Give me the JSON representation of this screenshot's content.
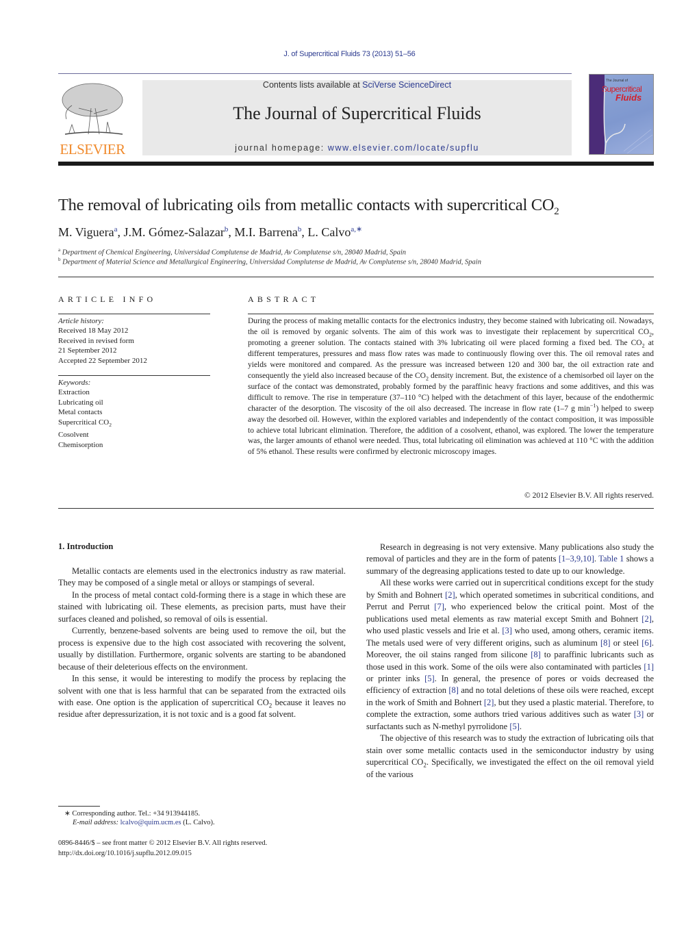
{
  "header": {
    "citation": "J. of Supercritical Fluids 73 (2013) 51–56",
    "contents_prefix": "Contents lists available at ",
    "contents_link": "SciVerse ScienceDirect",
    "journal_title": "The Journal of Supercritical Fluids",
    "homepage_prefix": "journal homepage: ",
    "homepage_link": "www.elsevier.com/locate/supflu",
    "publisher_logo_text": "ELSEVIER",
    "cover": {
      "small_text": "The Journal of",
      "title_line1": "Supercritical",
      "title_line2": "Fluids"
    },
    "colors": {
      "link": "#2b3a8f",
      "elsevier_orange": "#f08a2c",
      "cover_red": "#d4202a",
      "cover_purple": "#4b2c78"
    }
  },
  "article": {
    "title_main": "The removal of lubricating oils from metallic contacts with supercritical CO",
    "title_sub": "2",
    "authors": [
      {
        "name": "M. Viguera",
        "sup": "a"
      },
      {
        "name": "J.M. Gómez-Salazar",
        "sup": "b"
      },
      {
        "name": "M.I. Barrena",
        "sup": "b"
      },
      {
        "name": "L. Calvo",
        "sup": "a,∗"
      }
    ],
    "affiliations": [
      {
        "mark": "a",
        "text": "Department of Chemical Engineering, Universidad Complutense de Madrid, Av Complutense s/n, 28040 Madrid, Spain"
      },
      {
        "mark": "b",
        "text": "Department of Material Science and Metallurgical Engineering, Universidad Complutense de Madrid, Av Complutense s/n, 28040 Madrid, Spain"
      }
    ]
  },
  "article_info": {
    "heading": "ARTICLE INFO",
    "history_label": "Article history:",
    "history": [
      "Received 18 May 2012",
      "Received in revised form",
      "21 September 2012",
      "Accepted 22 September 2012"
    ],
    "keywords_label": "Keywords:",
    "keywords": [
      {
        "text": "Extraction"
      },
      {
        "text": "Lubricating oil"
      },
      {
        "text": "Metal contacts"
      },
      {
        "text": "Supercritical CO",
        "sub": "2"
      },
      {
        "text": "Cosolvent"
      },
      {
        "text": "Chemisorption"
      }
    ]
  },
  "abstract": {
    "heading": "ABSTRACT",
    "segments": [
      "During the process of making metallic contacts for the electronics industry, they become stained with lubricating oil. Nowadays, the oil is removed by organic solvents. The aim of this work was to investigate their replacement by supercritical CO",
      "2",
      ", promoting a greener solution. The contacts stained with 3% lubricating oil were placed forming a fixed bed. The CO",
      "2",
      " at different temperatures, pressures and mass flow rates was made to continuously flowing over this. The oil removal rates and yields were monitored and compared. As the pressure was increased between 120 and 300 bar, the oil extraction rate and consequently the yield also increased because of the CO",
      "2",
      " density increment. But, the existence of a chemisorbed oil layer on the surface of the contact was demonstrated, probably formed by the paraffinic heavy fractions and some additives, and this was difficult to remove. The rise in temperature (37–110 °C) helped with the detachment of this layer, because of the endothermic character of the desorption. The viscosity of the oil also decreased. The increase in flow rate (1–7 g min",
      "−1",
      ") helped to sweep away the desorbed oil. However, within the explored variables and independently of the contact composition, it was impossible to achieve total lubricant elimination. Therefore, the addition of a cosolvent, ethanol, was explored. The lower the temperature was, the larger amounts of ethanol were needed. Thus, total lubricating oil elimination was achieved at 110 °C with the addition of 5% ethanol. These results were confirmed by electronic microscopy images."
    ],
    "copyright": "© 2012 Elsevier B.V. All rights reserved."
  },
  "body": {
    "section_heading": "1.  Introduction",
    "left_paragraphs": [
      {
        "parts": [
          "Metallic contacts are elements used in the electronics industry as raw material. They may be composed of a single metal or alloys or stampings of several."
        ]
      },
      {
        "parts": [
          "In the process of metal contact cold-forming there is a stage in which these are stained with lubricating oil. These elements, as precision parts, must have their surfaces cleaned and polished, so removal of oils is essential."
        ]
      },
      {
        "parts": [
          "Currently, benzene-based solvents are being used to remove the oil, but the process is expensive due to the high cost associated with recovering the solvent, usually by distillation. Furthermore, organic solvents are starting to be abandoned because of their deleterious effects on the environment."
        ]
      },
      {
        "parts": [
          "In this sense, it would be interesting to modify the process by replacing the solvent with one that is less harmful that can be separated from the extracted oils with ease. One option is the application of supercritical CO",
          "2",
          " because it leaves no residue after depressurization, it is not toxic and is a good fat solvent."
        ]
      }
    ],
    "right_p1": [
      "Research in degreasing is not very extensive. Many publications also study the removal of particles and they are in the form of patents ",
      "[1–3,9,10]",
      ". ",
      "Table 1",
      " shows a summary of the degreasing applications tested to date up to our knowledge."
    ],
    "right_p2": [
      "All these works were carried out in supercritical conditions except for the study by Smith and Bohnert ",
      "[2]",
      ", which operated sometimes in subcritical conditions, and Perrut and Perrut ",
      "[7]",
      ", who experienced below the critical point. Most of the publications used metal elements as raw material except Smith and Bohnert ",
      "[2]",
      ", who used plastic vessels and Irie et al. ",
      "[3]",
      " who used, among others, ceramic items. The metals used were of very different origins, such as aluminum ",
      "[8]",
      " or steel ",
      "[6]",
      ". Moreover, the oil stains ranged from silicone ",
      "[8]",
      " to paraffinic lubricants such as those used in this work. Some of the oils were also contaminated with particles ",
      "[1]",
      " or printer inks ",
      "[5]",
      ". In general, the presence of pores or voids decreased the efficiency of extraction ",
      "[8]",
      " and no total deletions of these oils were reached, except in the work of Smith and Bohnert ",
      "[2]",
      ", but they used a plastic material. Therefore, to complete the extraction, some authors tried various additives such as water ",
      "[3]",
      " or surfactants such as N-methyl pyrrolidone ",
      "[5]",
      "."
    ],
    "right_p3": [
      "The objective of this research was to study the extraction of lubricating oils that stain over some metallic contacts used in the semiconductor industry by using supercritical CO",
      "2",
      ". Specifically, we investigated the effect on the oil removal yield of the various"
    ]
  },
  "footer": {
    "corresponding": "∗  Corresponding author. Tel.: +34 913944185.",
    "email_label": "E-mail address:",
    "email": "lcalvo@quim.ucm.es",
    "email_suffix": " (L. Calvo).",
    "issn_line": "0896-8446/$ – see front matter © 2012 Elsevier B.V. All rights reserved.",
    "doi": "http://dx.doi.org/10.1016/j.supflu.2012.09.015"
  }
}
